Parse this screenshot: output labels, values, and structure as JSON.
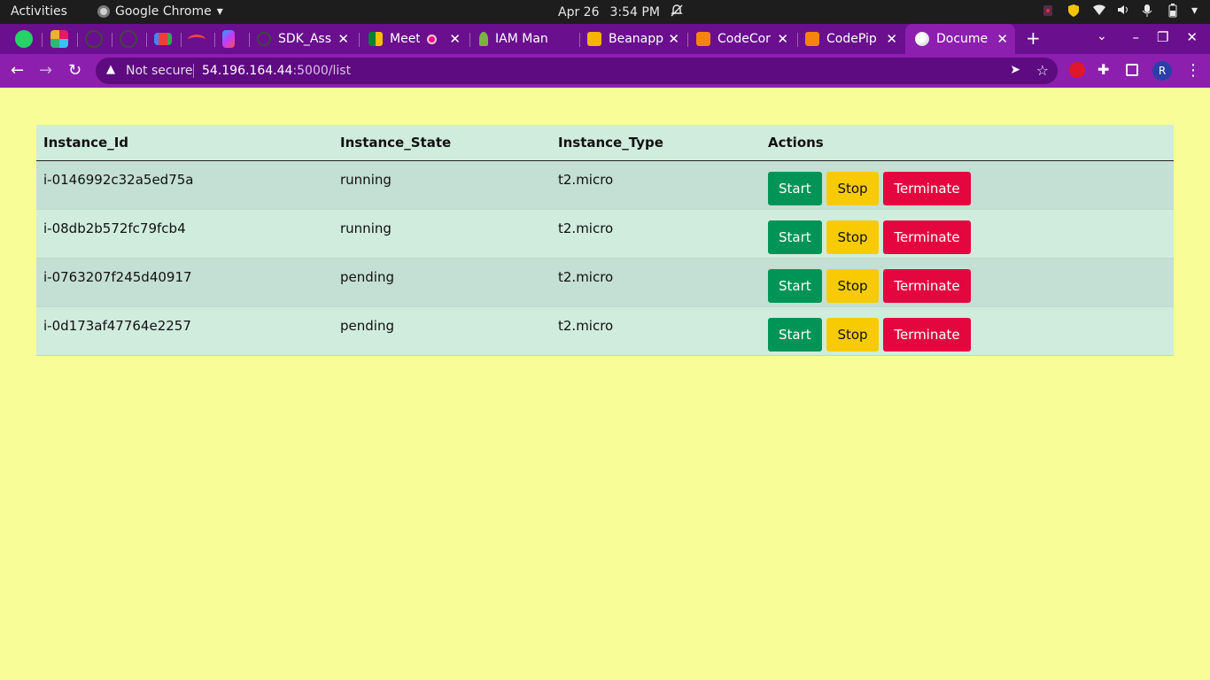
{
  "system_bar": {
    "activities": "Activities",
    "app_name": "Google Chrome",
    "date": "Apr 26",
    "time": "3:54 PM"
  },
  "tabs": [
    {
      "title": "SDK_Ass",
      "favicon": "github-icon"
    },
    {
      "title": "Meet",
      "favicon": "meet-icon"
    },
    {
      "title": "IAM Man",
      "favicon": "aws-iam-icon"
    },
    {
      "title": "Beanapp",
      "favicon": "beanstalk-icon"
    },
    {
      "title": "CodeCor",
      "favicon": "aws-codecommit-icon"
    },
    {
      "title": "CodePip",
      "favicon": "aws-codepipeline-icon"
    },
    {
      "title": "Docume",
      "favicon": "globe-icon",
      "active": true
    }
  ],
  "address_bar": {
    "security_label": "Not secure",
    "url_host": "54.196.164.44",
    "url_path": ":5000/list"
  },
  "profile": {
    "initial": "R"
  },
  "table": {
    "headers": {
      "id": "Instance_Id",
      "state": "Instance_State",
      "type": "Instance_Type",
      "actions": "Actions"
    },
    "rows": [
      {
        "id": "i-0146992c32a5ed75a",
        "state": "running",
        "type": "t2.micro"
      },
      {
        "id": "i-08db2b572fc79fcb4",
        "state": "running",
        "type": "t2.micro"
      },
      {
        "id": "i-0763207f245d40917",
        "state": "pending",
        "type": "t2.micro"
      },
      {
        "id": "i-0d173af47764e2257",
        "state": "pending",
        "type": "t2.micro"
      }
    ],
    "buttons": {
      "start": "Start",
      "stop": "Stop",
      "terminate": "Terminate"
    }
  },
  "colors": {
    "page_bg": "#f8fd98",
    "chrome_theme": "#8c1fae",
    "start": "#009457",
    "stop": "#f8cb00",
    "terminate": "#e3063f"
  }
}
